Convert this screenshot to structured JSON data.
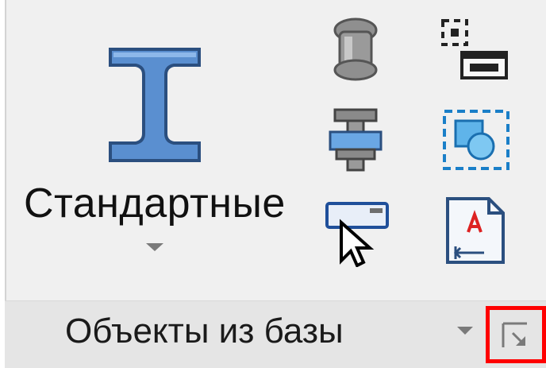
{
  "ribbon_panel": {
    "big_button": {
      "label": "Стандартные",
      "icon": "i-beam-profile-icon"
    },
    "small_buttons": [
      {
        "icon": "bolt-icon"
      },
      {
        "icon": "bolt-with-nut-icon"
      },
      {
        "icon": "cursor-select-icon"
      },
      {
        "icon": "object-snap-window-icon"
      },
      {
        "icon": "selection-frame-shapes-icon"
      },
      {
        "icon": "annotation-text-icon"
      }
    ],
    "footer": {
      "title": "Объекты из базы",
      "dropdown_icon": "chevron-down-icon",
      "launcher_icon": "dialog-launcher-icon",
      "highlight_color": "#ff0000"
    }
  },
  "colors": {
    "beam_fill": "#5a8fd0",
    "beam_stroke": "#2b4f7f",
    "panel_bg": "#f0f0f0",
    "footer_bg": "#e5e5e5"
  }
}
